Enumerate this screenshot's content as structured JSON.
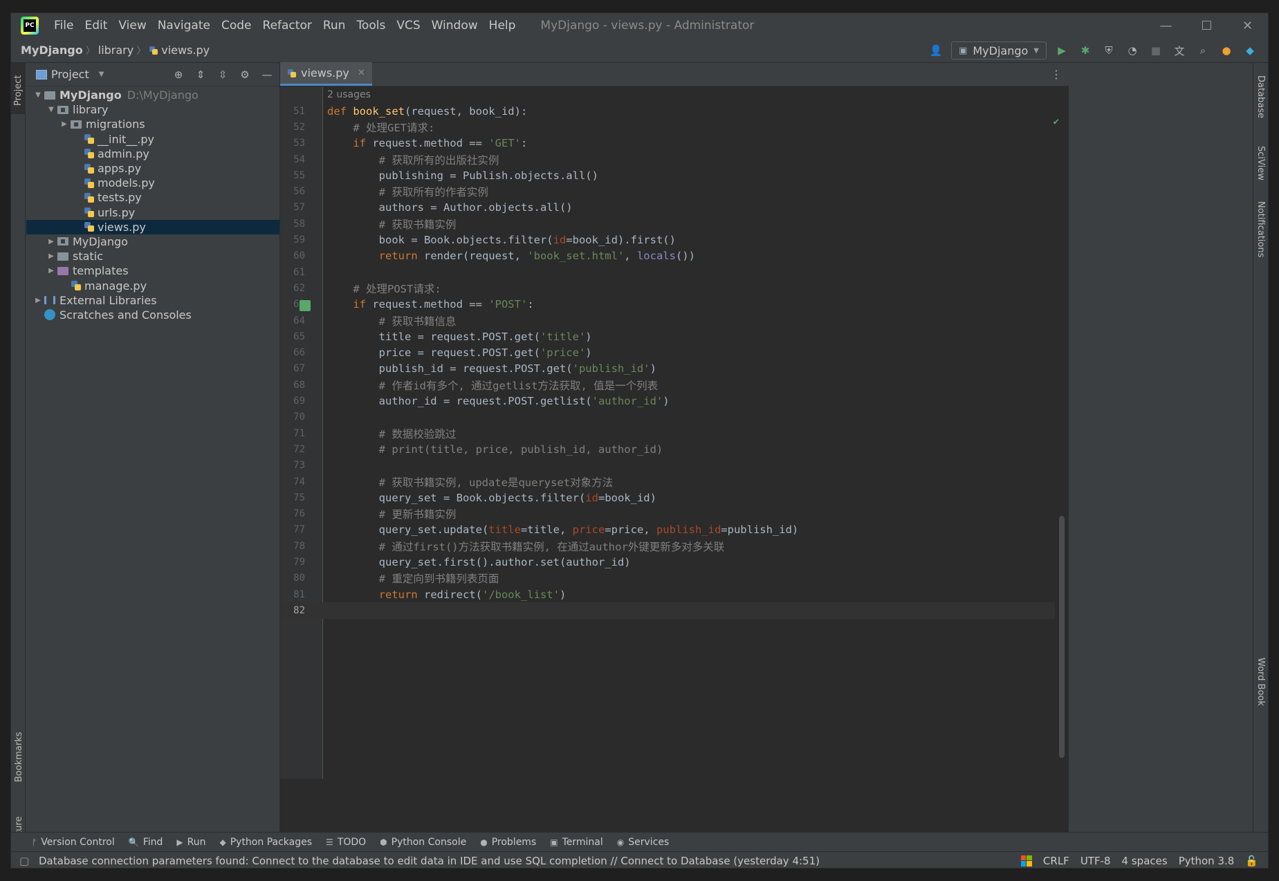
{
  "window": {
    "title": "MyDjango - views.py - Administrator",
    "menu": [
      "File",
      "Edit",
      "View",
      "Navigate",
      "Code",
      "Refactor",
      "Run",
      "Tools",
      "VCS",
      "Window",
      "Help"
    ],
    "controls": [
      "—",
      "☐",
      "✕"
    ]
  },
  "navbar": {
    "breadcrumb": [
      "MyDjango",
      "library",
      "views.py"
    ],
    "run_config": "MyDjango"
  },
  "side_tabs": {
    "left": [
      "Project",
      "Bookmarks",
      "Structure"
    ],
    "right": [
      "Database",
      "SciView",
      "Notifications",
      "Word Book"
    ]
  },
  "project": {
    "header": "Project",
    "tree": [
      {
        "label": "MyDjango",
        "path": "D:\\MyDjango",
        "depth": 0,
        "arrow": "▼",
        "kind": "folder",
        "bold": true
      },
      {
        "label": "library",
        "depth": 1,
        "arrow": "▼",
        "kind": "pkg"
      },
      {
        "label": "migrations",
        "depth": 2,
        "arrow": "▶",
        "kind": "pkg"
      },
      {
        "label": "__init__.py",
        "depth": 3,
        "kind": "py"
      },
      {
        "label": "admin.py",
        "depth": 3,
        "kind": "py"
      },
      {
        "label": "apps.py",
        "depth": 3,
        "kind": "py"
      },
      {
        "label": "models.py",
        "depth": 3,
        "kind": "py"
      },
      {
        "label": "tests.py",
        "depth": 3,
        "kind": "py"
      },
      {
        "label": "urls.py",
        "depth": 3,
        "kind": "py"
      },
      {
        "label": "views.py",
        "depth": 3,
        "kind": "py",
        "selected": true
      },
      {
        "label": "MyDjango",
        "depth": 1,
        "arrow": "▶",
        "kind": "pkg"
      },
      {
        "label": "static",
        "depth": 1,
        "arrow": "▶",
        "kind": "folder"
      },
      {
        "label": "templates",
        "depth": 1,
        "arrow": "▶",
        "kind": "purple"
      },
      {
        "label": "manage.py",
        "depth": 2,
        "kind": "py"
      },
      {
        "label": "External Libraries",
        "depth": 0,
        "arrow": "▶",
        "kind": "lib"
      },
      {
        "label": "Scratches and Consoles",
        "depth": 0,
        "kind": "scratch"
      }
    ]
  },
  "editor": {
    "tab": "views.py",
    "usages": "2 usages",
    "lines": [
      {
        "n": "51",
        "html": "<span class=\"kw\">def </span><span class=\"fn\">book_set</span>(request, book_id):"
      },
      {
        "n": "52",
        "html": "    <span class=\"cm\"># 处理GET请求:</span>"
      },
      {
        "n": "53",
        "html": "    <span class=\"kw\">if </span>request.method == <span class=\"str\">'GET'</span>:"
      },
      {
        "n": "54",
        "html": "        <span class=\"cm\"># 获取所有的出版社实例</span>"
      },
      {
        "n": "55",
        "html": "        publishing = Publish.objects.all()"
      },
      {
        "n": "56",
        "html": "        <span class=\"cm\"># 获取所有的作者实例</span>"
      },
      {
        "n": "57",
        "html": "        authors = Author.objects.all()"
      },
      {
        "n": "58",
        "html": "        <span class=\"cm\"># 获取书籍实例</span>"
      },
      {
        "n": "59",
        "html": "        book = Book.objects.filter(<span class=\"param\">id</span>=book_id).first()"
      },
      {
        "n": "60",
        "html": "        <span class=\"kw\">return </span>render(request, <span class=\"str\">'book_set.html'</span>, <span class=\"builtin\">locals</span>())"
      },
      {
        "n": "61",
        "html": ""
      },
      {
        "n": "62",
        "html": "    <span class=\"cm\"># 处理POST请求:</span>"
      },
      {
        "n": "63",
        "html": "    <span class=\"kw\">if </span>request.method == <span class=\"str\">'POST'</span>:"
      },
      {
        "n": "64",
        "html": "        <span class=\"cm\"># 获取书籍信息</span>"
      },
      {
        "n": "65",
        "html": "        title = request.POST.get(<span class=\"str\">'title'</span>)"
      },
      {
        "n": "66",
        "html": "        price = request.POST.get(<span class=\"str\">'price'</span>)"
      },
      {
        "n": "67",
        "html": "        publish_id = request.POST.get(<span class=\"str\">'publish_id'</span>)"
      },
      {
        "n": "68",
        "html": "        <span class=\"cm\"># 作者id有多个, 通过getlist方法获取, 值是一个列表</span>"
      },
      {
        "n": "69",
        "html": "        author_id = request.POST.getlist(<span class=\"str\">'author_id'</span>)"
      },
      {
        "n": "70",
        "html": ""
      },
      {
        "n": "71",
        "html": "        <span class=\"cm\"># 数据校验跳过</span>"
      },
      {
        "n": "72",
        "html": "        <span class=\"cm\"># print(title, price, publish_id, author_id)</span>"
      },
      {
        "n": "73",
        "html": ""
      },
      {
        "n": "74",
        "html": "        <span class=\"cm\"># 获取书籍实例, update是queryset对象方法</span>"
      },
      {
        "n": "75",
        "html": "        query_set = Book.objects.filter(<span class=\"param\">id</span>=book_id)"
      },
      {
        "n": "76",
        "html": "        <span class=\"cm\"># 更新书籍实例</span>"
      },
      {
        "n": "77",
        "html": "        query_set.update(<span class=\"param\">title</span>=title, <span class=\"param\">price</span>=price, <span class=\"param\">publish_id</span>=publish_id)"
      },
      {
        "n": "78",
        "html": "        <span class=\"cm\"># 通过first()方法获取书籍实例, 在通过author外键更新多对多关联</span>"
      },
      {
        "n": "79",
        "html": "        query_set.first().author.set(author_id)"
      },
      {
        "n": "80",
        "html": "        <span class=\"cm\"># 重定向到书籍列表页面</span>"
      },
      {
        "n": "81",
        "html": "        <span class=\"kw\">return </span>redirect(<span class=\"str\">'/book_list'</span>)"
      },
      {
        "n": "82",
        "html": "",
        "current": true
      }
    ]
  },
  "bottom_tools": [
    {
      "icon": "branch-icon",
      "glyph": "ᚠ",
      "label": "Version Control"
    },
    {
      "icon": "search-icon",
      "glyph": "🔍",
      "label": "Find"
    },
    {
      "icon": "run-icon",
      "glyph": "▶",
      "label": "Run"
    },
    {
      "icon": "packages-icon",
      "glyph": "◆",
      "label": "Python Packages"
    },
    {
      "icon": "todo-icon",
      "glyph": "☰",
      "label": "TODO"
    },
    {
      "icon": "console-icon",
      "glyph": "⬢",
      "label": "Python Console"
    },
    {
      "icon": "problems-icon",
      "glyph": "●",
      "label": "Problems"
    },
    {
      "icon": "terminal-icon",
      "glyph": "▣",
      "label": "Terminal"
    },
    {
      "icon": "services-icon",
      "glyph": "◉",
      "label": "Services"
    }
  ],
  "statusbar": {
    "message": "Database connection parameters found: Connect to the database to edit data in IDE and use SQL completion // Connect to Database (yesterday 4:51)",
    "line_sep": "CRLF",
    "encoding": "UTF-8",
    "indent": "4 spaces",
    "interpreter": "Python 3.8"
  },
  "colors": {
    "accent": "#4a88c7",
    "selection": "#0d293e",
    "keyword": "#cc7832",
    "string": "#6a8759",
    "comment": "#808080"
  }
}
